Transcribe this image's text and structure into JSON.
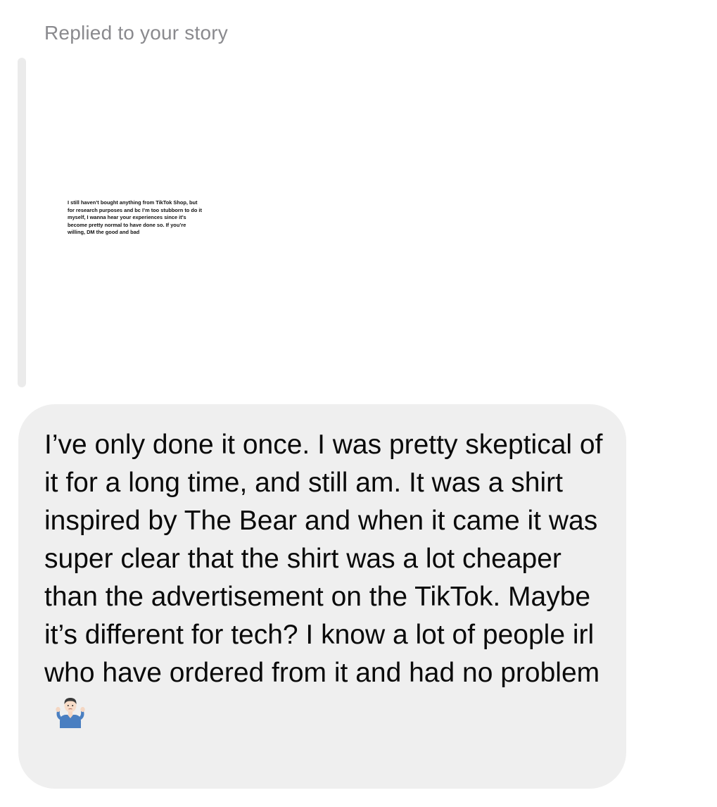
{
  "reply_label": "Replied to your story",
  "story": {
    "text": "I still haven’t bought anything from TikTok Shop, but for research purposes and bc I’m too stubborn to do it myself, I wanna hear your experiences since it’s become pretty normal to have done so. If you’re willing, DM the good and bad"
  },
  "message": {
    "text": "I’ve only done it once. I was pretty skeptical of it for a long time, and still am. It was a shirt inspired by The Bear and when it came it was super clear that the shirt was a lot cheaper than the advertisement on the TikTok. Maybe it’s different for tech? I know a lot of people irl who have ordered from it and had no problem",
    "emoji": "man-shrugging-emoji"
  },
  "colors": {
    "bubble_bg": "#efefef",
    "label_gray": "#8a8a8e",
    "story_bar": "#ebebeb"
  }
}
